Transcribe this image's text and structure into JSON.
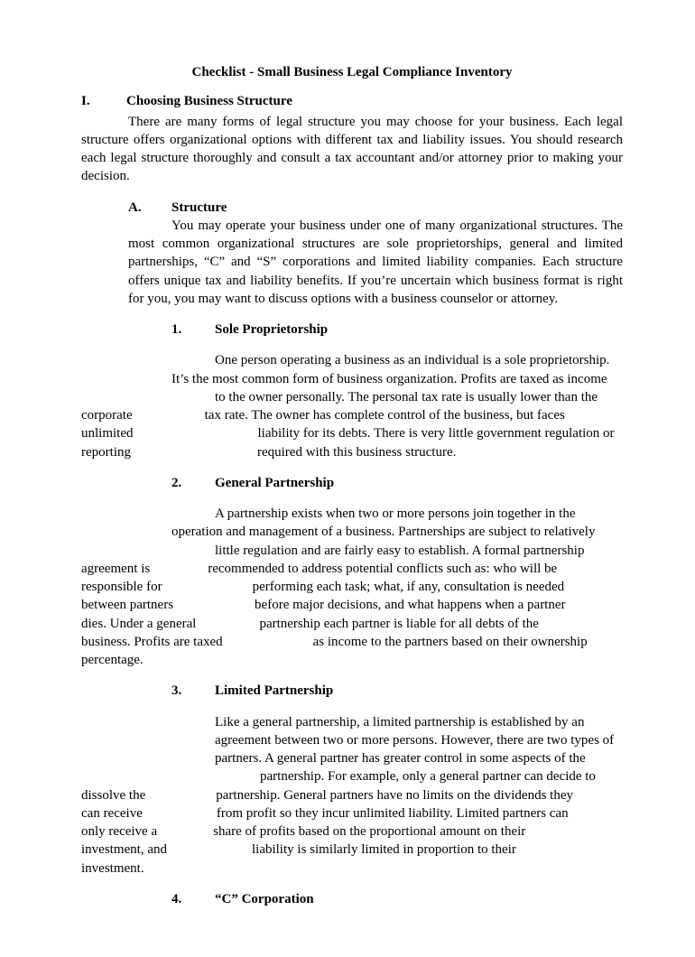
{
  "title": "Checklist - Small Business Legal Compliance Inventory",
  "sectionI": {
    "num": "I.",
    "heading": "Choosing Business Structure",
    "para": "There are many forms of legal structure you may choose for your business. Each legal structure offers organizational options with different tax and liability issues. You should research each legal structure thoroughly and consult a tax accountant and/or attorney prior to making your decision."
  },
  "subA": {
    "letter": "A.",
    "heading": "Structure",
    "para": "You may operate your business under one of many organizational structures. The most common organizational structures are sole proprietorships, general and limited partnerships, “C” and “S” corporations and limited liability companies. Each structure offers unique tax and liability benefits. If you’re uncertain which business format is right for you, you may want to discuss options with a business counselor or attorney."
  },
  "item1": {
    "num": "1.",
    "heading": "Sole Proprietorship",
    "l1": "One person operating a business as an individual is a sole proprietorship.",
    "l2a": "It’s the most common form of business organization. Profits are taxed as income",
    "l2b": "to the owner personally. The personal tax rate is usually lower than the",
    "l3a": "corporate",
    "l3b": "tax rate. The owner has complete control of the business, but faces",
    "l4a": "unlimited",
    "l4b": "liability for its debts. There is very little government regulation or",
    "l5a": "reporting",
    "l5b": "required with this business structure."
  },
  "item2": {
    "num": "2.",
    "heading": "General Partnership",
    "l1": "A partnership exists when two or more persons join together in the",
    "l2a": "operation and management of a business. Partnerships are subject to relatively",
    "l2b": "little regulation and are fairly easy to establish. A formal partnership",
    "l3a": "agreement is",
    "l3b": "recommended to address potential conflicts such as: who will be",
    "l4a": "responsible for",
    "l4b": "performing each task; what, if any, consultation is needed",
    "l5a": "between partners",
    "l5b": "before major decisions, and what happens when a partner",
    "l6a": "dies. Under a general",
    "l6b": "partnership each partner is liable for all debts of the",
    "l7a": "business. Profits are taxed",
    "l7b": "as income to the partners based on their ownership",
    "l8": "percentage."
  },
  "item3": {
    "num": "3.",
    "heading": "Limited Partnership",
    "l1": "Like a general partnership, a limited partnership is established by an",
    "l2": "agreement between two or more persons. However, there are two types of",
    "l3": "partners. A general partner has greater control in some aspects of the",
    "l4": "partnership. For example, only a general partner can decide to",
    "l5a": "dissolve the",
    "l5b": "partnership. General partners have no limits on the dividends they",
    "l6a": "can receive",
    "l6b": "from profit so they incur unlimited liability. Limited partners can",
    "l7a": "only receive a",
    "l7b": "share of profits based on the proportional amount on their",
    "l8a": "investment, and",
    "l8b": "liability is similarly limited in proportion to their",
    "l9": "investment."
  },
  "item4": {
    "num": "4.",
    "heading": "“C” Corporation"
  }
}
